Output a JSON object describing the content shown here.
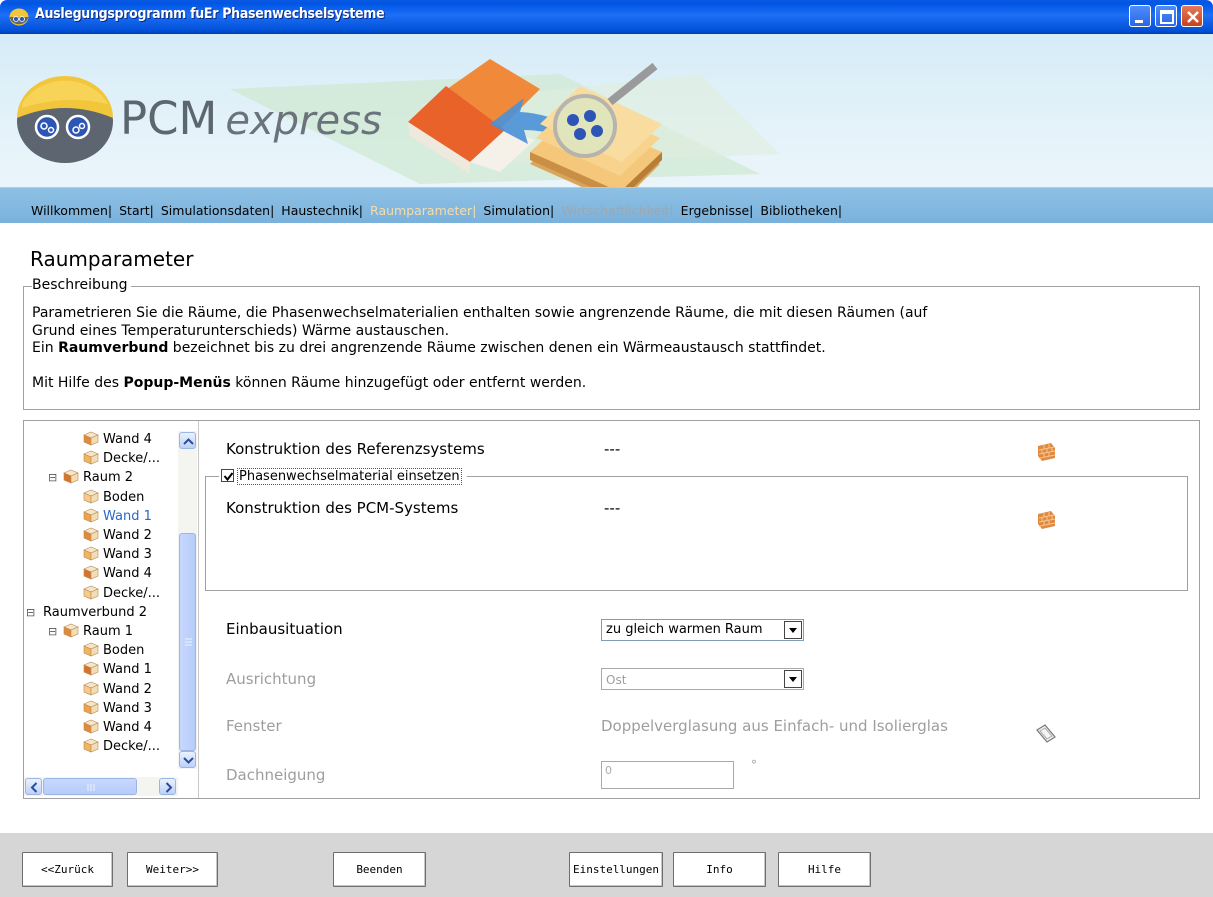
{
  "window": {
    "title": "Auslegungsprogramm fuEr Phasenwechselsysteme"
  },
  "brand": {
    "name": "PCM",
    "sub": "express"
  },
  "nav": {
    "items": [
      {
        "label": "Willkommen|",
        "state": "normal"
      },
      {
        "label": "Start|",
        "state": "normal"
      },
      {
        "label": "Simulationsdaten|",
        "state": "normal"
      },
      {
        "label": "Haustechnik|",
        "state": "normal"
      },
      {
        "label": "Raumparameter|",
        "state": "active"
      },
      {
        "label": "Simulation|",
        "state": "normal"
      },
      {
        "label": "Wirtschaftlichkeit|",
        "state": "disabled"
      },
      {
        "label": "Ergebnisse|",
        "state": "normal"
      },
      {
        "label": "Bibliotheken|",
        "state": "normal"
      }
    ]
  },
  "page": {
    "title": "Raumparameter"
  },
  "description": {
    "legend": "Beschreibung",
    "line1": "Parametrieren Sie die Räume, die Phasenwechselmaterialien enthalten sowie angrenzende Räume, die mit diesen Räumen (auf",
    "line2": "Grund eines Temperaturunterschieds) Wärme austauschen.",
    "line3_pre": "Ein ",
    "line3_bold": "Raumverbund",
    "line3_post": " bezeichnet bis zu drei angrenzende Räume zwischen denen ein Wärmeaustausch stattfindet.",
    "line4_pre": "Mit Hilfe des ",
    "line4_bold": "Popup-Menüs",
    "line4_post": " können Räume hinzugefügt oder entfernt werden."
  },
  "tree": {
    "items": [
      {
        "label": "Wand 4",
        "expander": "",
        "level": 2
      },
      {
        "label": "Decke/...",
        "expander": "",
        "level": 2
      },
      {
        "label": "Raum 2",
        "expander": "⊟",
        "level": 1
      },
      {
        "label": "Boden",
        "expander": "",
        "level": 2
      },
      {
        "label": "Wand 1",
        "expander": "",
        "level": 2,
        "selected": true
      },
      {
        "label": "Wand 2",
        "expander": "",
        "level": 2
      },
      {
        "label": "Wand 3",
        "expander": "",
        "level": 2
      },
      {
        "label": "Wand 4",
        "expander": "",
        "level": 2
      },
      {
        "label": "Decke/...",
        "expander": "",
        "level": 2
      },
      {
        "label": "Raumverbund 2",
        "expander": "⊟",
        "level": 0
      },
      {
        "label": "Raum 1",
        "expander": "⊟",
        "level": 1
      },
      {
        "label": "Boden",
        "expander": "",
        "level": 2
      },
      {
        "label": "Wand 1",
        "expander": "",
        "level": 2
      },
      {
        "label": "Wand 2",
        "expander": "",
        "level": 2
      },
      {
        "label": "Wand 3",
        "expander": "",
        "level": 2
      },
      {
        "label": "Wand 4",
        "expander": "",
        "level": 2
      },
      {
        "label": "Decke/...",
        "expander": "",
        "level": 2
      }
    ]
  },
  "form": {
    "ref_label": "Konstruktion des Referenzsystems",
    "ref_value": "---",
    "pcm_checkbox_label": "Phasenwechselmaterial einsetzen",
    "pcm_checked": true,
    "pcm_label": "Konstruktion des PCM-Systems",
    "pcm_value": "---",
    "einbau_label": "Einbausituation",
    "einbau_value": "zu gleich warmen Raum",
    "ausrichtung_label": "Ausrichtung",
    "ausrichtung_value": "Ost",
    "fenster_label": "Fenster",
    "fenster_value": "Doppelverglasung  aus Einfach- und Isolierglas",
    "dach_label": "Dachneigung",
    "dach_value": "0",
    "dach_unit": "°"
  },
  "footer": {
    "back": "<<Zurück",
    "next": "Weiter>>",
    "quit": "Beenden",
    "settings": "Einstellungen",
    "info": "Info",
    "help": "Hilfe"
  },
  "colors": {
    "title_bar": "#0055e5",
    "nav_bg": "#86bbe1",
    "nav_active": "#f5dca8",
    "nav_disabled": "#9aa8b2",
    "footer_bg": "#d6d6d6",
    "selected_tree": "#2a67c8"
  }
}
